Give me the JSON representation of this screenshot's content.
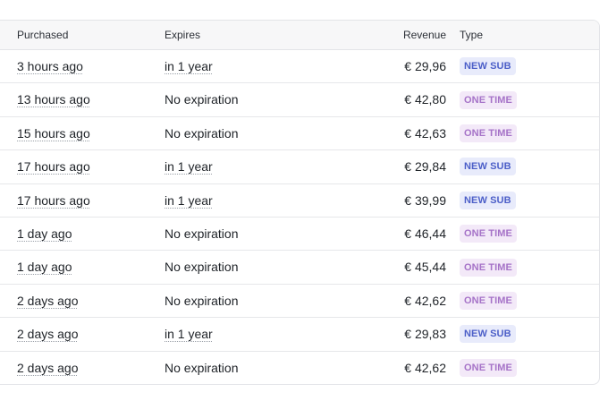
{
  "columns": {
    "purchased": "Purchased",
    "expires": "Expires",
    "revenue": "Revenue",
    "type": "Type"
  },
  "colors": {
    "new_sub_bg": "#e8ebfb",
    "new_sub_fg": "#4c5fc8",
    "one_time_bg": "#f3e9f8",
    "one_time_fg": "#a673c8"
  },
  "rows": [
    {
      "purchased": "3 hours ago",
      "expires": "in 1 year",
      "revenue": "€ 29,96",
      "type": "NEW SUB",
      "kind": "sub"
    },
    {
      "purchased": "13 hours ago",
      "expires": "No expiration",
      "revenue": "€ 42,80",
      "type": "ONE TIME",
      "kind": "onetime"
    },
    {
      "purchased": "15 hours ago",
      "expires": "No expiration",
      "revenue": "€ 42,63",
      "type": "ONE TIME",
      "kind": "onetime"
    },
    {
      "purchased": "17 hours ago",
      "expires": "in 1 year",
      "revenue": "€ 29,84",
      "type": "NEW SUB",
      "kind": "sub"
    },
    {
      "purchased": "17 hours ago",
      "expires": "in 1 year",
      "revenue": "€ 39,99",
      "type": "NEW SUB",
      "kind": "sub"
    },
    {
      "purchased": "1 day ago",
      "expires": "No expiration",
      "revenue": "€ 46,44",
      "type": "ONE TIME",
      "kind": "onetime"
    },
    {
      "purchased": "1 day ago",
      "expires": "No expiration",
      "revenue": "€ 45,44",
      "type": "ONE TIME",
      "kind": "onetime"
    },
    {
      "purchased": "2 days ago",
      "expires": "No expiration",
      "revenue": "€ 42,62",
      "type": "ONE TIME",
      "kind": "onetime"
    },
    {
      "purchased": "2 days ago",
      "expires": "in 1 year",
      "revenue": "€ 29,83",
      "type": "NEW SUB",
      "kind": "sub"
    },
    {
      "purchased": "2 days ago",
      "expires": "No expiration",
      "revenue": "€ 42,62",
      "type": "ONE TIME",
      "kind": "onetime"
    }
  ]
}
